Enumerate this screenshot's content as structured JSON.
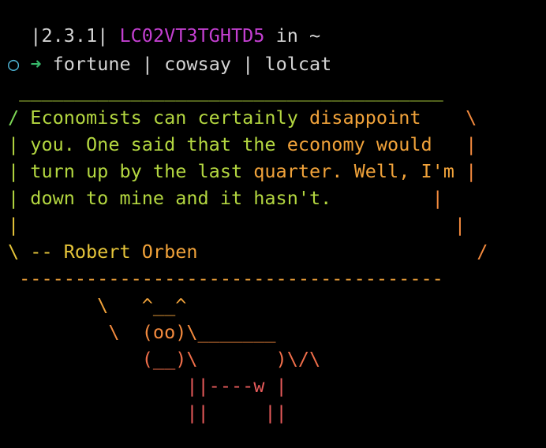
{
  "prompt": {
    "version": "|2.3.1|",
    "hostname": "LC02VT3TGHTD5",
    "in_word": "in",
    "dir": "~",
    "circle": "○",
    "arrow": "➜",
    "command": "fortune | cowsay | lolcat"
  },
  "cowsay": {
    "top_border": " ______________________________________",
    "lines": [
      [
        "/ ",
        "Economists can certainly ",
        "disappoint",
        "    \\"
      ],
      [
        "| ",
        "you. One said that the ",
        "economy would",
        "   |"
      ],
      [
        "| ",
        "turn up by the last ",
        "quarter. Well, I'm",
        " |"
      ],
      [
        "| ",
        "down to mine and it hasn't.",
        "",
        "         |"
      ],
      [
        "| ",
        "",
        "",
        "                                      |"
      ],
      [
        "\\ ",
        "-- Robert ",
        "Orben",
        "                         /"
      ]
    ],
    "bottom_border": " --------------------------------------",
    "cow": [
      "        \\   ^__^",
      "         \\  (oo)\\_______",
      "            (__)\\       )\\/\\",
      "                ||----w |",
      "                ||     ||"
    ]
  },
  "colors": {
    "background": "#000000",
    "hostname": "#c33fd0",
    "circle": "#4fb7d8",
    "arrow": "#36b86a",
    "text": "#d4d4d4"
  }
}
